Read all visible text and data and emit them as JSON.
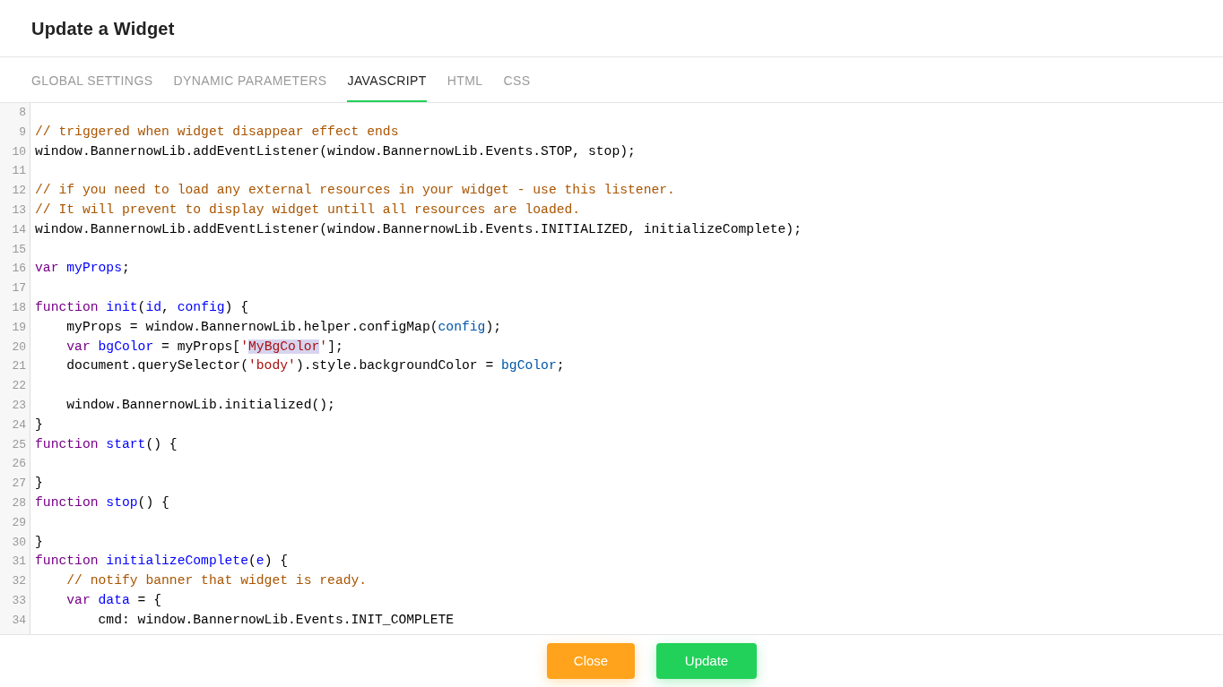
{
  "dialog": {
    "title": "Update a Widget"
  },
  "tabs": [
    {
      "label": "GLOBAL SETTINGS",
      "selected": false
    },
    {
      "label": "DYNAMIC PARAMETERS",
      "selected": false
    },
    {
      "label": "JAVASCRIPT",
      "selected": true
    },
    {
      "label": "HTML",
      "selected": false
    },
    {
      "label": "CSS",
      "selected": false
    }
  ],
  "code_lines": [
    {
      "number": "8"
    },
    {
      "number": "9",
      "tokens": [
        {
          "kind": "comment",
          "text": "// triggered when widget disappear effect ends"
        }
      ]
    },
    {
      "number": "10",
      "tokens": [
        {
          "kind": "plain",
          "text": "window.BannernowLib.addEventListener(window.BannernowLib.Events.STOP, stop);"
        }
      ]
    },
    {
      "number": "11"
    },
    {
      "number": "12",
      "tokens": [
        {
          "kind": "comment",
          "text": "// if you need to load any external resources in your widget - use this listener."
        }
      ]
    },
    {
      "number": "13",
      "tokens": [
        {
          "kind": "comment",
          "text": "// It will prevent to display widget untill all resources are loaded."
        }
      ]
    },
    {
      "number": "14",
      "tokens": [
        {
          "kind": "plain",
          "text": "window.BannernowLib.addEventListener(window.BannernowLib.Events.INITIALIZED, initializeComplete);"
        }
      ]
    },
    {
      "number": "15"
    },
    {
      "number": "16",
      "tokens": [
        {
          "kind": "keyword",
          "text": "var"
        },
        {
          "kind": "def",
          "text": " myProps"
        },
        {
          "kind": "plain",
          "text": ";"
        }
      ]
    },
    {
      "number": "17"
    },
    {
      "number": "18",
      "tokens": [
        {
          "kind": "keyword",
          "text": "function"
        },
        {
          "kind": "def",
          "text": " init"
        },
        {
          "kind": "plain",
          "text": "("
        },
        {
          "kind": "def",
          "text": "id"
        },
        {
          "kind": "plain",
          "text": ", "
        },
        {
          "kind": "def",
          "text": "config"
        },
        {
          "kind": "plain",
          "text": ") {"
        }
      ]
    },
    {
      "number": "19",
      "tokens": [
        {
          "kind": "plain",
          "text": "    myProps = window.BannernowLib.helper.configMap("
        },
        {
          "kind": "variable",
          "text": "config"
        },
        {
          "kind": "plain",
          "text": ");"
        }
      ]
    },
    {
      "number": "20",
      "tokens": [
        {
          "kind": "keyword",
          "text": "    var"
        },
        {
          "kind": "def",
          "text": " bgColor"
        },
        {
          "kind": "plain",
          "text": " = myProps["
        },
        {
          "kind": "string",
          "text": "'"
        },
        {
          "kind": "string-match",
          "text": "MyBgColor"
        },
        {
          "kind": "string",
          "text": "'"
        },
        {
          "kind": "plain",
          "text": "];"
        }
      ]
    },
    {
      "number": "21",
      "tokens": [
        {
          "kind": "plain",
          "text": "    document.querySelector("
        },
        {
          "kind": "string",
          "text": "'body'"
        },
        {
          "kind": "plain",
          "text": ").style.backgroundColor = "
        },
        {
          "kind": "variable",
          "text": "bgColor"
        },
        {
          "kind": "plain",
          "text": ";"
        }
      ]
    },
    {
      "number": "22"
    },
    {
      "number": "23",
      "tokens": [
        {
          "kind": "plain",
          "text": "    window.BannernowLib.initialized();"
        }
      ]
    },
    {
      "number": "24",
      "tokens": [
        {
          "kind": "plain",
          "text": "}"
        }
      ]
    },
    {
      "number": "25",
      "tokens": [
        {
          "kind": "keyword",
          "text": "function"
        },
        {
          "kind": "def",
          "text": " start"
        },
        {
          "kind": "plain",
          "text": "() {"
        }
      ]
    },
    {
      "number": "26"
    },
    {
      "number": "27",
      "tokens": [
        {
          "kind": "plain",
          "text": "}"
        }
      ]
    },
    {
      "number": "28",
      "tokens": [
        {
          "kind": "keyword",
          "text": "function"
        },
        {
          "kind": "def",
          "text": " stop"
        },
        {
          "kind": "plain",
          "text": "() {"
        }
      ]
    },
    {
      "number": "29"
    },
    {
      "number": "30",
      "tokens": [
        {
          "kind": "plain",
          "text": "}"
        }
      ]
    },
    {
      "number": "31",
      "tokens": [
        {
          "kind": "keyword",
          "text": "function"
        },
        {
          "kind": "def",
          "text": " initializeComplete"
        },
        {
          "kind": "plain",
          "text": "("
        },
        {
          "kind": "def",
          "text": "e"
        },
        {
          "kind": "plain",
          "text": ") {"
        }
      ]
    },
    {
      "number": "32",
      "tokens": [
        {
          "kind": "comment",
          "text": "    // notify banner that widget is ready."
        }
      ]
    },
    {
      "number": "33",
      "tokens": [
        {
          "kind": "keyword",
          "text": "    var"
        },
        {
          "kind": "def",
          "text": " data"
        },
        {
          "kind": "plain",
          "text": " = {"
        }
      ]
    },
    {
      "number": "34",
      "tokens": [
        {
          "kind": "plain",
          "text": "        cmd: window.BannernowLib.Events.INIT_COMPLETE"
        }
      ]
    }
  ],
  "buttons": [
    {
      "kind": "close",
      "label": "Close"
    },
    {
      "kind": "update",
      "label": "Update"
    }
  ]
}
